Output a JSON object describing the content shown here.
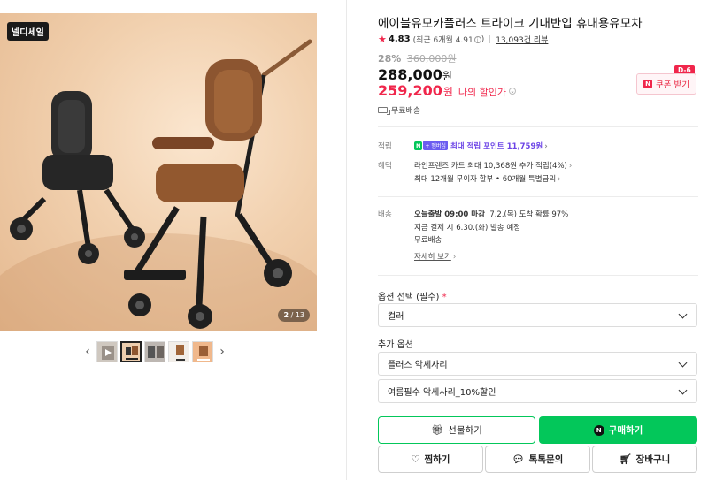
{
  "gallery": {
    "badge": "넬디세일",
    "counter_current": "2",
    "counter_total": "13",
    "prev_icon": "chevron-left-icon",
    "next_icon": "chevron-right-icon"
  },
  "product": {
    "title": "에이블유모카플러스 트라이크 기내반입 휴대용유모차",
    "rating": "4.83",
    "rating_recent": "(최근 6개월 4.91",
    "reviews": "13,093건 리뷰",
    "discount_rate": "28%",
    "original_price": "360,000원",
    "price": "288,000",
    "price_unit": "원",
    "my_price": "259,200",
    "my_price_unit": "원",
    "my_price_label": "나의 할인가",
    "free_shipping": "무료배송"
  },
  "coupon": {
    "tag": "D-6",
    "label": "쿠폰 받기",
    "n_mark": "N"
  },
  "benefits": {
    "points_label": "적립",
    "points_n": "N",
    "points_pay": "+ 멤버십",
    "points_text": "최대 적립 포인트 11,759원",
    "benefit_label": "혜택",
    "benefit_line1": "라인프렌즈 카드 최대 10,368원 추가 적립(4%)",
    "benefit_line2": "최대 12개월 무이자 할부 • 60개월 특별금리"
  },
  "shipping": {
    "label": "배송",
    "line1_bold": "오늘출발 09:00 마감",
    "line1_rest": "7.2.(목) 도착 확률 97%",
    "line2": "지금 결제 시 6.30.(화) 발송 예정",
    "line3": "무료배송",
    "more": "자세히 보기"
  },
  "options": {
    "required_label": "옵션 선택 (필수)",
    "required_mark": "*",
    "color_select": "컬러",
    "additional_label": "추가 옵션",
    "addon1": "플러스 악세사리",
    "addon2": "여름필수 악세사리_10%할인"
  },
  "actions": {
    "gift": "선물하기",
    "buy": "구매하기",
    "buy_n": "N",
    "zzim": "찜하기",
    "talk": "톡톡문의",
    "cart": "장바구니"
  },
  "colors": {
    "accent_green": "#03c75a",
    "sale_red": "#f0264b",
    "point_purple": "#6b43e6"
  }
}
